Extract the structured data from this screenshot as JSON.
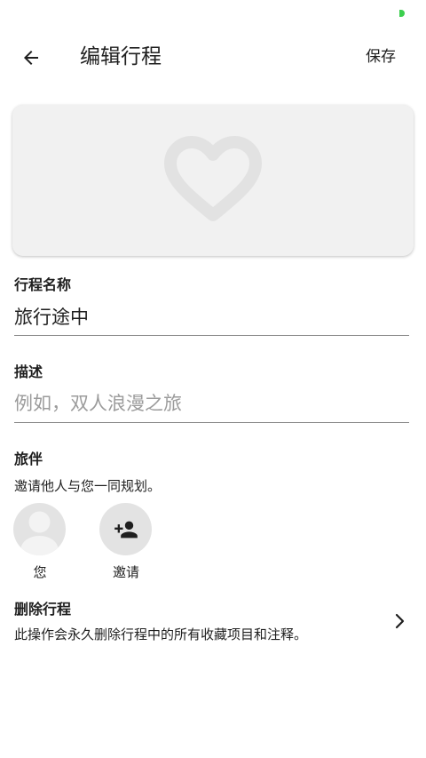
{
  "header": {
    "title": "编辑行程",
    "save_label": "保存"
  },
  "trip_name": {
    "label": "行程名称",
    "value": "旅行途中"
  },
  "description": {
    "label": "描述",
    "value": "",
    "placeholder": "例如，双人浪漫之旅"
  },
  "companions": {
    "title": "旅伴",
    "subtitle": "邀请他人与您一同规划。",
    "you_label": "您",
    "invite_label": "邀请"
  },
  "delete_trip": {
    "title": "删除行程",
    "description": "此操作会永久删除行程中的所有收藏项目和注释。"
  },
  "icons": {
    "back": "arrow-left-icon",
    "cover": "heart-icon",
    "avatar": "person-icon",
    "invite": "person-add-icon",
    "chevron": "chevron-right-icon"
  },
  "colors": {
    "status_indicator": "#3ccf4e",
    "cover_background": "#f1f1f1",
    "heart": "#e2e2e2",
    "avatar_background": "#e3e3e3"
  }
}
